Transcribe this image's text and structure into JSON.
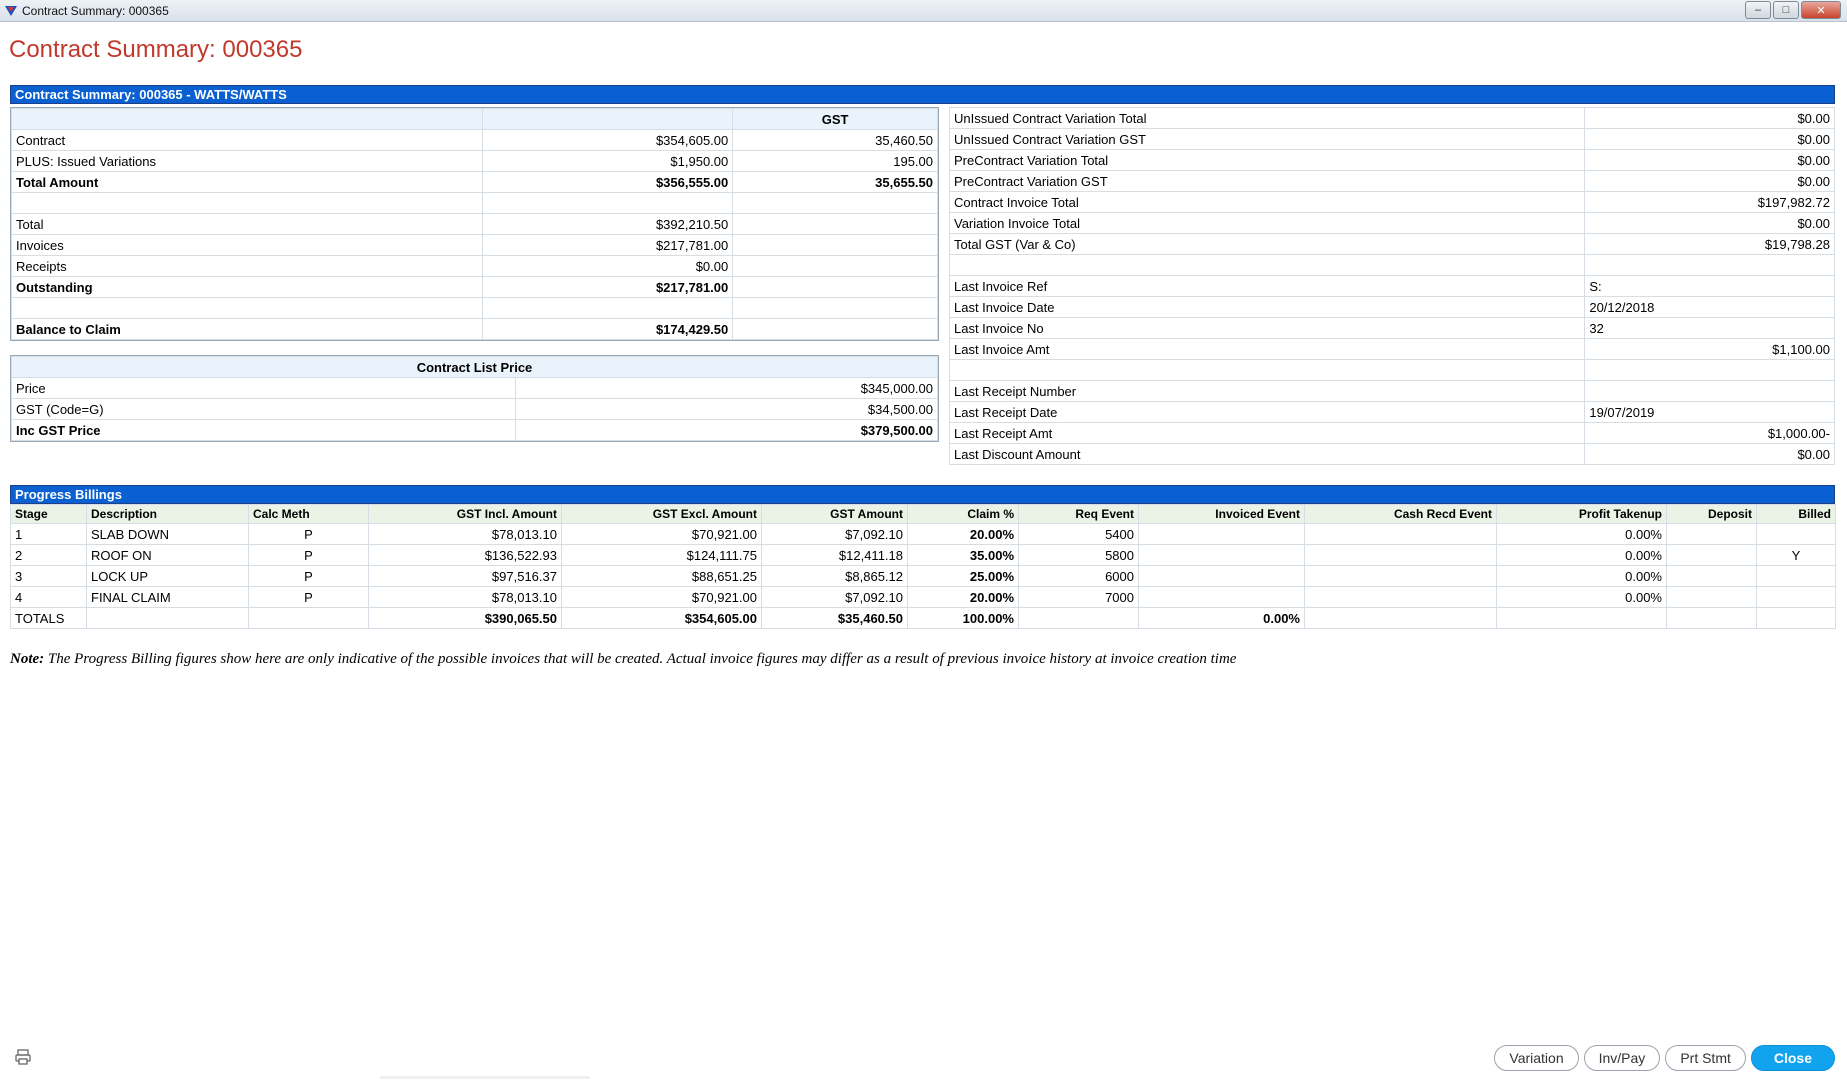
{
  "window": {
    "title": "Contract Summary: 000365",
    "controls": [
      "–",
      "□",
      "✕"
    ]
  },
  "page_title": "Contract Summary: 000365",
  "summary": {
    "header": "Contract Summary: 000365 - WATTS/WATTS",
    "gst_col_header": "GST",
    "rows": [
      {
        "label": "Contract",
        "amount": "$354,605.00",
        "gst": "35,460.50",
        "bold": false
      },
      {
        "label": "PLUS: Issued Variations",
        "amount": "$1,950.00",
        "gst": "195.00",
        "bold": false
      },
      {
        "label": "Total Amount",
        "amount": "$356,555.00",
        "gst": "35,655.50",
        "bold": true
      },
      {
        "label": "",
        "amount": "",
        "gst": "",
        "bold": false
      },
      {
        "label": "Total",
        "amount": "$392,210.50",
        "gst": "",
        "bold": false
      },
      {
        "label": "Invoices",
        "amount": "$217,781.00",
        "gst": "",
        "bold": false
      },
      {
        "label": "Receipts",
        "amount": "$0.00",
        "gst": "",
        "bold": false
      },
      {
        "label": "Outstanding",
        "amount": "$217,781.00",
        "gst": "",
        "bold": true
      },
      {
        "label": "",
        "amount": "",
        "gst": "",
        "bold": false
      },
      {
        "label": "Balance to Claim",
        "amount": "$174,429.50",
        "gst": "",
        "bold": true
      }
    ],
    "right_rows": [
      {
        "label": "UnIssued Contract Variation Total",
        "value": "$0.00",
        "align": "right"
      },
      {
        "label": "UnIssued Contract Variation GST",
        "value": "$0.00",
        "align": "right"
      },
      {
        "label": "PreContract Variation Total",
        "value": "$0.00",
        "align": "right"
      },
      {
        "label": "PreContract Variation GST",
        "value": "$0.00",
        "align": "right"
      },
      {
        "label": "Contract Invoice Total",
        "value": "$197,982.72",
        "align": "right"
      },
      {
        "label": "Variation Invoice Total",
        "value": "$0.00",
        "align": "right"
      },
      {
        "label": "Total GST (Var & Co)",
        "value": "$19,798.28",
        "align": "right"
      },
      {
        "label": "",
        "value": "",
        "align": "right"
      },
      {
        "label": "Last Invoice Ref",
        "value": "S:",
        "align": "left"
      },
      {
        "label": "Last Invoice Date",
        "value": "20/12/2018",
        "align": "left"
      },
      {
        "label": "Last Invoice No",
        "value": "32",
        "align": "left"
      },
      {
        "label": "Last Invoice Amt",
        "value": "$1,100.00",
        "align": "right"
      },
      {
        "label": "",
        "value": "",
        "align": "right"
      },
      {
        "label": "Last Receipt Number",
        "value": "",
        "align": "left"
      },
      {
        "label": "Last Receipt Date",
        "value": "19/07/2019",
        "align": "left"
      },
      {
        "label": "Last Receipt Amt",
        "value": "$1,000.00-",
        "align": "right"
      },
      {
        "label": "Last Discount Amount",
        "value": "$0.00",
        "align": "right"
      }
    ]
  },
  "list_price": {
    "header": "Contract List Price",
    "rows": [
      {
        "label": "Price",
        "value": "$345,000.00",
        "bold": false
      },
      {
        "label": "GST (Code=G)",
        "value": "$34,500.00",
        "bold": false
      },
      {
        "label": "Inc GST Price",
        "value": "$379,500.00",
        "bold": true
      }
    ]
  },
  "billings": {
    "header": "Progress Billings",
    "columns": [
      "Stage",
      "Description",
      "Calc Meth",
      "GST Incl. Amount",
      "GST Excl. Amount",
      "GST Amount",
      "Claim %",
      "Req Event",
      "Invoiced Event",
      "Cash Recd Event",
      "Profit Takenup",
      "Deposit",
      "Billed"
    ],
    "rows": [
      {
        "stage": "1",
        "desc": "SLAB DOWN",
        "calc": "P",
        "incl": "$78,013.10",
        "excl": "$70,921.00",
        "gst": "$7,092.10",
        "claim": "20.00%",
        "req": "5400",
        "inv": "",
        "cash": "",
        "profit": "0.00%",
        "deposit": "",
        "billed": ""
      },
      {
        "stage": "2",
        "desc": "ROOF ON",
        "calc": "P",
        "incl": "$136,522.93",
        "excl": "$124,111.75",
        "gst": "$12,411.18",
        "claim": "35.00%",
        "req": "5800",
        "inv": "",
        "cash": "",
        "profit": "0.00%",
        "deposit": "",
        "billed": "Y"
      },
      {
        "stage": "3",
        "desc": "LOCK UP",
        "calc": "P",
        "incl": "$97,516.37",
        "excl": "$88,651.25",
        "gst": "$8,865.12",
        "claim": "25.00%",
        "req": "6000",
        "inv": "",
        "cash": "",
        "profit": "0.00%",
        "deposit": "",
        "billed": ""
      },
      {
        "stage": "4",
        "desc": "FINAL CLAIM",
        "calc": "P",
        "incl": "$78,013.10",
        "excl": "$70,921.00",
        "gst": "$7,092.10",
        "claim": "20.00%",
        "req": "7000",
        "inv": "",
        "cash": "",
        "profit": "0.00%",
        "deposit": "",
        "billed": ""
      }
    ],
    "totals": {
      "label": "TOTALS",
      "incl": "$390,065.50",
      "excl": "$354,605.00",
      "gst": "$35,460.50",
      "claim": "100.00%",
      "inv": "0.00%"
    }
  },
  "note": {
    "label": "Note:",
    "text": "The Progress Billing figures show here are only indicative of the possible invoices that will be created. Actual invoice figures may differ as a result of previous invoice history at invoice creation time"
  },
  "buttons": {
    "variation": "Variation",
    "invpay": "Inv/Pay",
    "prtstmt": "Prt Stmt",
    "close": "Close"
  },
  "icons": {
    "app": "app-logo-icon",
    "print": "printer-icon"
  },
  "colors": {
    "header_blue": "#0a5fd1",
    "title_red": "#c0392b",
    "close_button": "#12a3ee"
  }
}
